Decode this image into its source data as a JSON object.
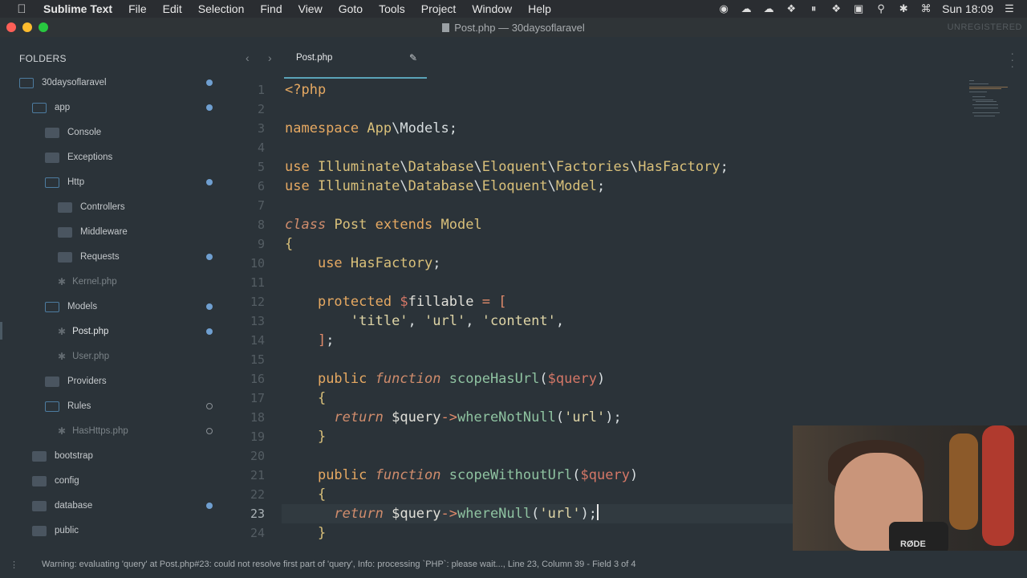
{
  "menubar": {
    "app_name": "Sublime Text",
    "menus": [
      "File",
      "Edit",
      "Selection",
      "Find",
      "View",
      "Goto",
      "Tools",
      "Project",
      "Window",
      "Help"
    ],
    "clock": "Sun 18:09"
  },
  "window": {
    "title": "Post.php — 30daysoflaravel",
    "license": "UNREGISTERED"
  },
  "sidebar": {
    "header": "FOLDERS",
    "items": [
      {
        "label": "30daysoflaravel",
        "kind": "folder-open",
        "dot": "filled"
      },
      {
        "label": "app",
        "kind": "folder-open",
        "dot": "filled"
      },
      {
        "label": "Console",
        "kind": "folder-closed",
        "dot": ""
      },
      {
        "label": "Exceptions",
        "kind": "folder-closed",
        "dot": ""
      },
      {
        "label": "Http",
        "kind": "folder-open",
        "dot": "filled"
      },
      {
        "label": "Controllers",
        "kind": "folder-closed",
        "dot": ""
      },
      {
        "label": "Middleware",
        "kind": "folder-closed",
        "dot": ""
      },
      {
        "label": "Requests",
        "kind": "folder-closed",
        "dot": "filled"
      },
      {
        "label": "Kernel.php",
        "kind": "file",
        "dot": ""
      },
      {
        "label": "Models",
        "kind": "folder-open",
        "dot": "filled"
      },
      {
        "label": "Post.php",
        "kind": "file-active",
        "dot": "filled"
      },
      {
        "label": "User.php",
        "kind": "file",
        "dot": ""
      },
      {
        "label": "Providers",
        "kind": "folder-closed",
        "dot": ""
      },
      {
        "label": "Rules",
        "kind": "folder-open",
        "dot": "hollow"
      },
      {
        "label": "HasHttps.php",
        "kind": "file",
        "dot": "hollow"
      },
      {
        "label": "bootstrap",
        "kind": "folder-closed",
        "dot": ""
      },
      {
        "label": "config",
        "kind": "folder-closed",
        "dot": ""
      },
      {
        "label": "database",
        "kind": "folder-closed",
        "dot": "filled"
      },
      {
        "label": "public",
        "kind": "folder-closed",
        "dot": ""
      }
    ]
  },
  "tab": {
    "label": "Post.php"
  },
  "editor": {
    "current_line": 23,
    "line_numbers": [
      "1",
      "2",
      "3",
      "4",
      "5",
      "6",
      "7",
      "8",
      "9",
      "10",
      "11",
      "12",
      "13",
      "14",
      "15",
      "16",
      "17",
      "18",
      "19",
      "20",
      "21",
      "22",
      "23",
      "24"
    ]
  },
  "statusbar": {
    "text": "Warning: evaluating 'query' at Post.php#23: could not resolve first part of 'query', Info: processing `PHP`: please wait..., Line 23, Column 39 - Field 3 of 4"
  },
  "webcam": {
    "mic_brand": "RØDE"
  }
}
